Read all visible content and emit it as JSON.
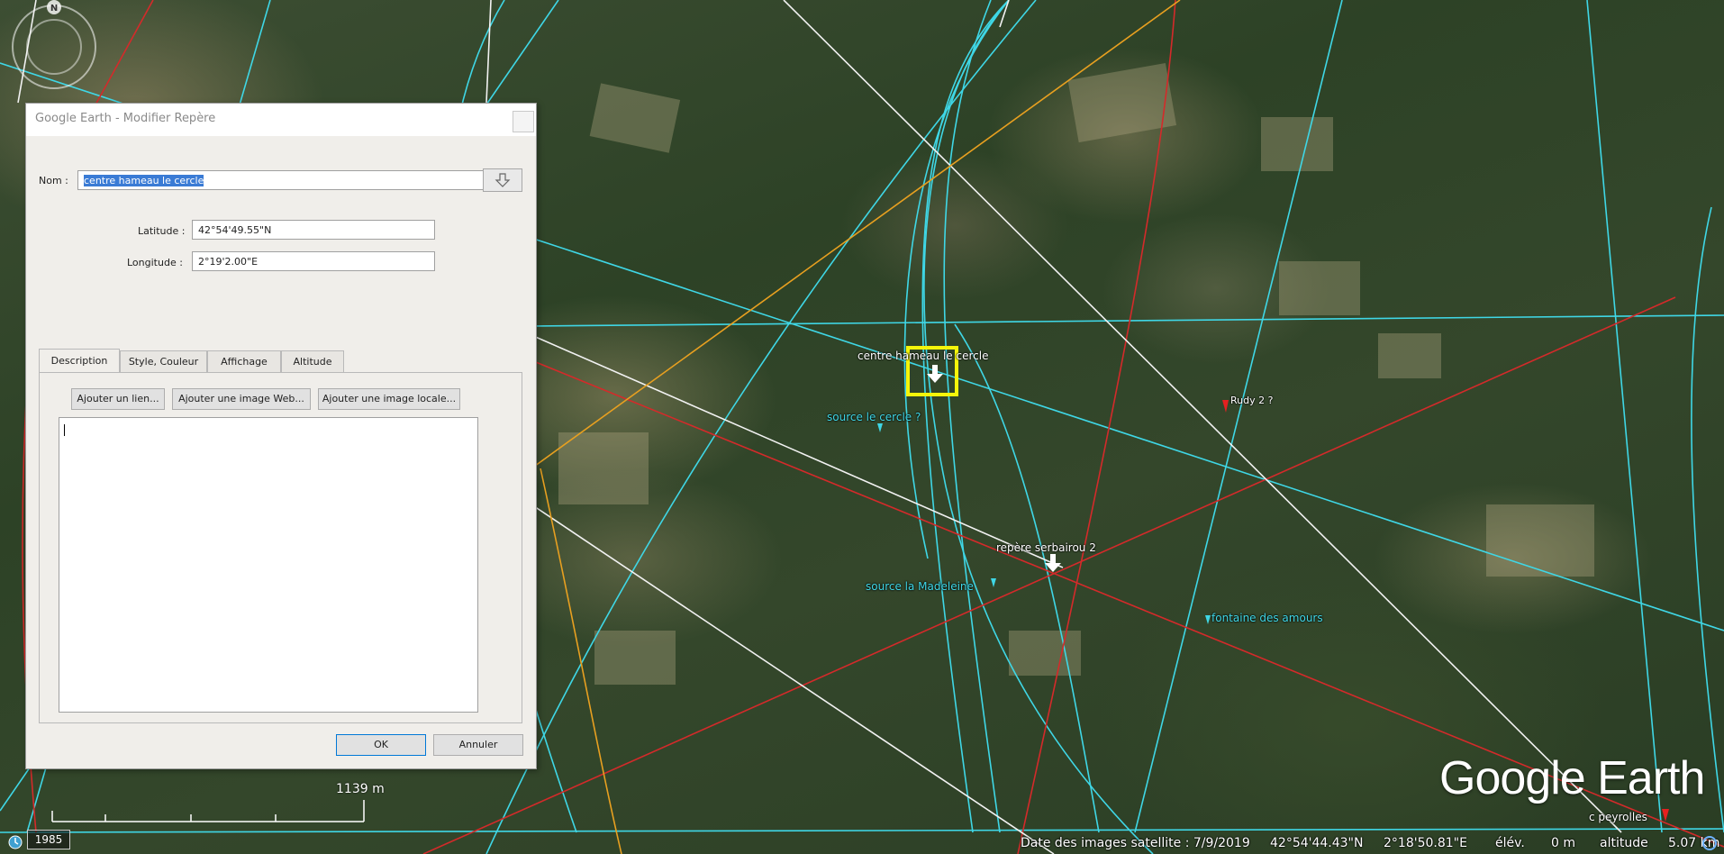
{
  "dialog": {
    "title": "Google Earth - Modifier Repère",
    "name_label": "Nom :",
    "name_value": "centre hameau le cercle",
    "latitude_label": "Latitude :",
    "latitude_value": "42°54'49.55\"N",
    "longitude_label": "Longitude :",
    "longitude_value": "2°19'2.00\"E",
    "tabs": [
      {
        "label": "Description",
        "active": true
      },
      {
        "label": "Style, Couleur",
        "active": false
      },
      {
        "label": "Affichage",
        "active": false
      },
      {
        "label": "Altitude",
        "active": false
      }
    ],
    "buttons": {
      "add_link": "Ajouter un lien...",
      "add_web_image": "Ajouter une image Web...",
      "add_local_image": "Ajouter une image locale...",
      "ok": "OK",
      "cancel": "Annuler"
    },
    "description_value": ""
  },
  "map": {
    "placemarks": [
      {
        "label": "centre hameau le cercle",
        "color": "#ffffff"
      },
      {
        "label": "source le cercle ?",
        "color": "#3fd7e6"
      },
      {
        "label": "Rudy 2 ?",
        "color": "#ffffff"
      },
      {
        "label": "repère serbairou 2",
        "color": "#ffffff"
      },
      {
        "label": "source la Madeleine",
        "color": "#3fd7e6"
      },
      {
        "label": "fontaine des amours",
        "color": "#3fd7e6"
      },
      {
        "label": "c peyrolles",
        "color": "#ffffff"
      }
    ],
    "line_colors": {
      "cyan": "#3fd7e6",
      "red": "#d42a2a",
      "white": "#f2f2f2",
      "orange": "#e8a020"
    },
    "scale_label": "1139 m",
    "year": "1985",
    "compass_north": "N"
  },
  "brand": {
    "logo_text": "Google Earth"
  },
  "status": {
    "imagery_date": "Date des images satellite : 7/9/2019",
    "lat": "42°54'44.43\"N",
    "lon": "2°18'50.81\"E",
    "elev_label": "élév.",
    "elev_value": "0 m",
    "altitude_label": "altitude",
    "altitude_value": "5.07 km"
  }
}
